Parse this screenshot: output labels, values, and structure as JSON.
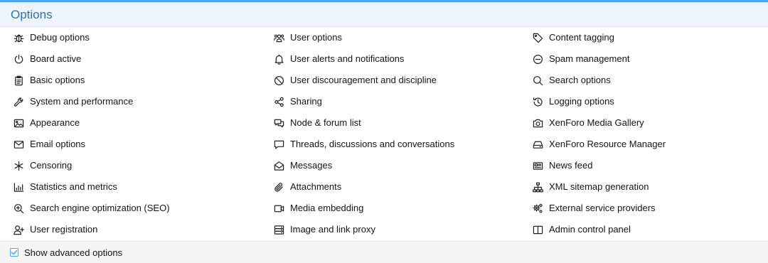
{
  "panel": {
    "title": "Options"
  },
  "columns": [
    [
      {
        "label": "Debug options",
        "icon": "bug-icon"
      },
      {
        "label": "Board active",
        "icon": "power-icon"
      },
      {
        "label": "Basic options",
        "icon": "clipboard-icon"
      },
      {
        "label": "System and performance",
        "icon": "wrench-icon"
      },
      {
        "label": "Appearance",
        "icon": "image-icon"
      },
      {
        "label": "Email options",
        "icon": "envelope-icon"
      },
      {
        "label": "Censoring",
        "icon": "asterisk-icon"
      },
      {
        "label": "Statistics and metrics",
        "icon": "bar-chart-icon"
      },
      {
        "label": "Search engine optimization (SEO)",
        "icon": "search-plus-icon"
      },
      {
        "label": "User registration",
        "icon": "user-plus-icon"
      }
    ],
    [
      {
        "label": "User options",
        "icon": "users-icon"
      },
      {
        "label": "User alerts and notifications",
        "icon": "bell-icon"
      },
      {
        "label": "User discouragement and discipline",
        "icon": "ban-icon"
      },
      {
        "label": "Sharing",
        "icon": "share-icon"
      },
      {
        "label": "Node & forum list",
        "icon": "comments-icon"
      },
      {
        "label": "Threads, discussions and conversations",
        "icon": "comment-icon"
      },
      {
        "label": "Messages",
        "icon": "envelope-open-icon"
      },
      {
        "label": "Attachments",
        "icon": "paperclip-icon"
      },
      {
        "label": "Media embedding",
        "icon": "video-icon"
      },
      {
        "label": "Image and link proxy",
        "icon": "server-icon"
      }
    ],
    [
      {
        "label": "Content tagging",
        "icon": "tag-icon"
      },
      {
        "label": "Spam management",
        "icon": "minus-circle-icon"
      },
      {
        "label": "Search options",
        "icon": "search-icon"
      },
      {
        "label": "Logging options",
        "icon": "history-icon"
      },
      {
        "label": "XenForo Media Gallery",
        "icon": "camera-icon"
      },
      {
        "label": "XenForo Resource Manager",
        "icon": "hdd-icon"
      },
      {
        "label": "News feed",
        "icon": "newspaper-icon"
      },
      {
        "label": "XML sitemap generation",
        "icon": "sitemap-icon"
      },
      {
        "label": "External service providers",
        "icon": "cogs-icon"
      },
      {
        "label": "Admin control panel",
        "icon": "columns-icon"
      }
    ]
  ],
  "footer": {
    "show_advanced_label": "Show advanced options",
    "show_advanced_checked": true
  },
  "colors": {
    "accent": "#47a7eb",
    "title": "#2577b1",
    "header_bg": "#eef4fb",
    "footer_bg": "#f5f5f5"
  }
}
